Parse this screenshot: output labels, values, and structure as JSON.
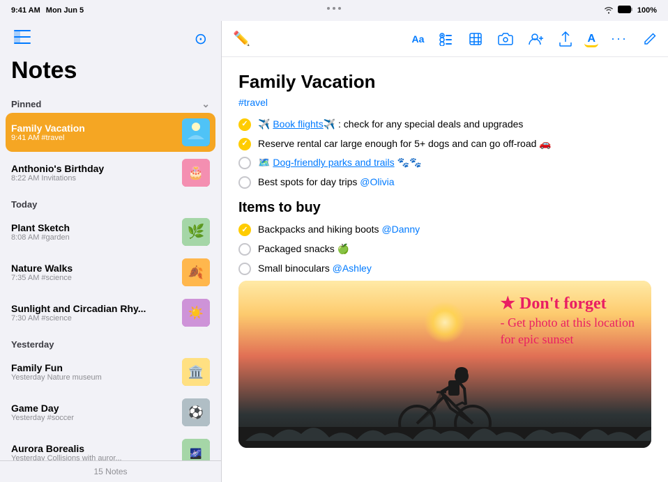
{
  "statusBar": {
    "time": "9:41 AM",
    "date": "Mon Jun 5",
    "wifi": "WiFi",
    "battery": "100%"
  },
  "dotsIndicator": "• • •",
  "sidebar": {
    "title": "Notes",
    "sections": [
      {
        "name": "Pinned",
        "items": [
          {
            "id": "family-vacation",
            "title": "Family Vacation",
            "meta": "9:41 AM  #travel",
            "active": true,
            "thumb": "vacation"
          },
          {
            "id": "anthonios-birthday",
            "title": "Anthonio's Birthday",
            "meta": "8:22 AM  Invitations",
            "active": false,
            "thumb": "birthday"
          }
        ]
      },
      {
        "name": "Today",
        "items": [
          {
            "id": "plant-sketch",
            "title": "Plant Sketch",
            "meta": "8:08 AM  #garden",
            "active": false,
            "thumb": "plant"
          },
          {
            "id": "nature-walks",
            "title": "Nature Walks",
            "meta": "7:35 AM  #science",
            "active": false,
            "thumb": "nature"
          },
          {
            "id": "sunlight-circadian",
            "title": "Sunlight and Circadian Rhy...",
            "meta": "7:30 AM  #science",
            "active": false,
            "thumb": "solar"
          }
        ]
      },
      {
        "name": "Yesterday",
        "items": [
          {
            "id": "family-fun",
            "title": "Family Fun",
            "meta": "Yesterday  Nature museum",
            "active": false,
            "thumb": "family"
          },
          {
            "id": "game-day",
            "title": "Game Day",
            "meta": "Yesterday  #soccer",
            "active": false,
            "thumb": "game"
          },
          {
            "id": "aurora-borealis",
            "title": "Aurora Borealis",
            "meta": "Yesterday  Collisions with auror...",
            "active": false,
            "thumb": "aurora"
          }
        ]
      }
    ],
    "footer": "15 Notes"
  },
  "toolbar": {
    "back_icon": "←",
    "font_icon": "Aa",
    "list_icon": "≡",
    "table_icon": "⊞",
    "camera_icon": "📷",
    "person_icon": "👤",
    "share_icon": "↑",
    "highlight_icon": "A",
    "more_icon": "•••",
    "compose_icon": "✏️"
  },
  "note": {
    "title": "Family Vacation",
    "hashtag": "#travel",
    "checklist": [
      {
        "checked": true,
        "text": "✈️ Book flights✈️ : check for any special deals and upgrades",
        "link": "Book flights"
      },
      {
        "checked": true,
        "text": "Reserve rental car large enough for 5+ dogs and can go off-road 🚗",
        "link": null
      },
      {
        "checked": false,
        "text": "🗺️ Dog-friendly parks and trails 🐾🐾",
        "link": "Dog-friendly parks and trails"
      },
      {
        "checked": false,
        "text": "Best spots for day trips @Olivia",
        "link": null,
        "mention": "@Olivia"
      }
    ],
    "section2_title": "Items to buy",
    "checklist2": [
      {
        "checked": true,
        "text": "Backpacks and hiking boots @Danny",
        "mention": "@Danny"
      },
      {
        "checked": false,
        "text": "Packaged snacks 🍏",
        "link": null
      },
      {
        "checked": false,
        "text": "Small binoculars @Ashley",
        "mention": "@Ashley"
      }
    ],
    "image_handwriting_line1": "★ Don't forget",
    "image_handwriting_line2": "- Get photo at this location",
    "image_handwriting_line3": "for epic sunset"
  }
}
